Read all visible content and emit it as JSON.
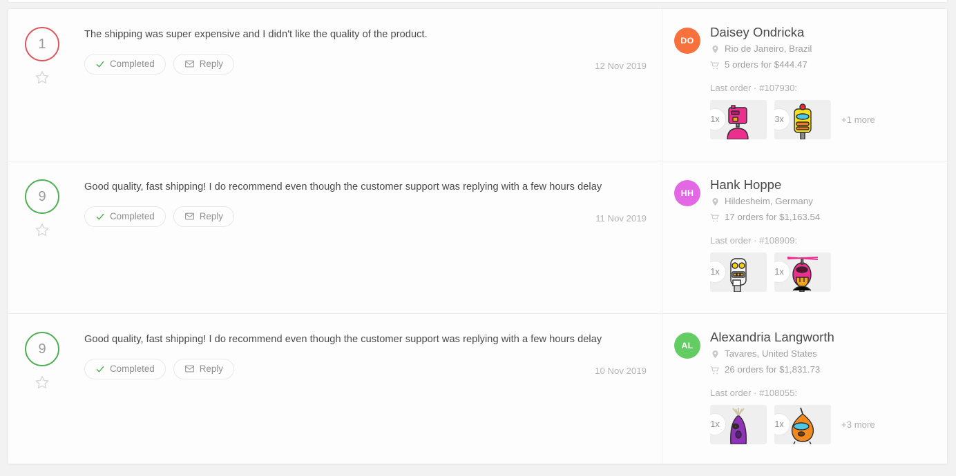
{
  "colors": {
    "score_good": "#4caf50",
    "score_bad": "#e2555a",
    "check_green": "#4caf50",
    "text_primary": "#4a4a4a",
    "text_muted": "#9e9e9e"
  },
  "reviews": [
    {
      "score": "1",
      "score_tone": "bad",
      "text": "The shipping was super expensive and I didn't like the quality of the product.",
      "status_label": "Completed",
      "reply_label": "Reply",
      "date": "12 Nov 2019",
      "favorite_icon": "star-icon",
      "customer": {
        "initials": "DO",
        "avatar_color": "#f8703c",
        "name": "Daisey Ondricka",
        "location": "Rio de Janeiro, Brazil",
        "orders": "5 orders for $444.47",
        "last_order": "Last order · #107930:",
        "items": [
          {
            "qty": "1x",
            "art": "robot-pink-boxhead"
          },
          {
            "qty": "3x",
            "art": "robot-yellow-canister"
          }
        ],
        "more": "+1 more"
      }
    },
    {
      "score": "9",
      "score_tone": "good",
      "text": "Good quality, fast shipping! I do recommend even though the customer support was replying with a few hours delay",
      "status_label": "Completed",
      "reply_label": "Reply",
      "date": "11 Nov 2019",
      "favorite_icon": "star-icon",
      "customer": {
        "initials": "HH",
        "avatar_color": "#e368e3",
        "name": "Hank Hoppe",
        "location": "Hildesheim, Germany",
        "orders": "17 orders for $1,163.54",
        "last_order": "Last order · #108909:",
        "items": [
          {
            "qty": "1x",
            "art": "robot-white-tower"
          },
          {
            "qty": "1x",
            "art": "robot-pink-copter"
          }
        ],
        "more": ""
      }
    },
    {
      "score": "9",
      "score_tone": "good",
      "text": "Good quality, fast shipping! I do recommend even though the customer support was replying with a few hours delay",
      "status_label": "Completed",
      "reply_label": "Reply",
      "date": "10 Nov 2019",
      "favorite_icon": "star-icon",
      "customer": {
        "initials": "AL",
        "avatar_color": "#63cc63",
        "name": "Alexandria Langworth",
        "location": "Tavares, United States",
        "orders": "26 orders for $1,831.73",
        "last_order": "Last order · #108055:",
        "items": [
          {
            "qty": "1x",
            "art": "robot-purple-sprout"
          },
          {
            "qty": "1x",
            "art": "robot-orange-bulb"
          }
        ],
        "more": "+3 more"
      }
    }
  ]
}
